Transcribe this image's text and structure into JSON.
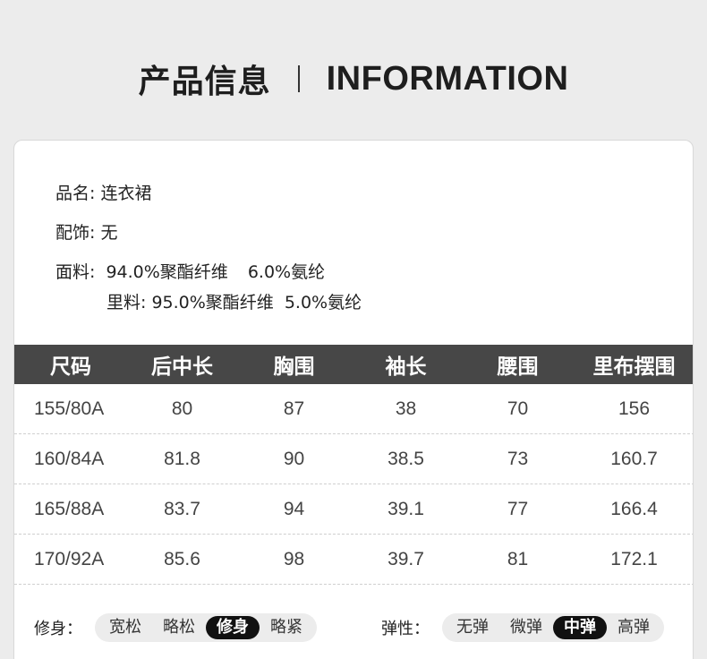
{
  "header": {
    "title_cn": "产品信息",
    "title_en": "INFORMATION"
  },
  "info": {
    "name": "品名: 连衣裙",
    "accessory": "配饰: 无",
    "fabric_label": "面料:",
    "fabric_1": "94.0%聚酯纤维",
    "fabric_2": "6.0%氨纶",
    "lining_label": "里料:",
    "lining_1": "95.0%聚酯纤维",
    "lining_2": "5.0%氨纶"
  },
  "table": {
    "headers": [
      "尺码",
      "后中长",
      "胸围",
      "袖长",
      "腰围",
      "里布摆围"
    ],
    "rows": [
      [
        "155/80A",
        "80",
        "87",
        "38",
        "70",
        "156"
      ],
      [
        "160/84A",
        "81.8",
        "90",
        "38.5",
        "73",
        "160.7"
      ],
      [
        "165/88A",
        "83.7",
        "94",
        "39.1",
        "77",
        "166.4"
      ],
      [
        "170/92A",
        "85.6",
        "98",
        "39.7",
        "81",
        "172.1"
      ]
    ]
  },
  "fit": {
    "label": "修身：",
    "options": [
      "宽松",
      "略松",
      "修身",
      "略紧"
    ],
    "selected": "修身"
  },
  "elasticity": {
    "label": "弹性：",
    "options": [
      "无弹",
      "微弹",
      "中弹",
      "高弹"
    ],
    "selected": "中弹"
  }
}
